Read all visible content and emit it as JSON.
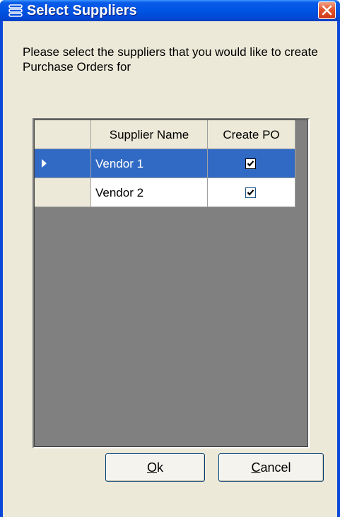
{
  "window": {
    "title": "Select Suppliers",
    "icon": "list-icon",
    "close_icon": "close-icon"
  },
  "prompt": "Please select the suppliers that you would like to create Purchase Orders for",
  "grid": {
    "columns": [
      "Supplier Name",
      "Create PO"
    ],
    "rows": [
      {
        "name": "Vendor 1",
        "create_po": true,
        "selected": true
      },
      {
        "name": "Vendor 2",
        "create_po": true,
        "selected": false
      }
    ]
  },
  "buttons": {
    "ok_accel": "O",
    "ok_rest": "k",
    "cancel_accel": "C",
    "cancel_rest": "ancel"
  },
  "colors": {
    "title_bar": "#0055e5",
    "selection": "#316ac5",
    "grid_background": "#808080",
    "dialog_face": "#ece9d8"
  }
}
